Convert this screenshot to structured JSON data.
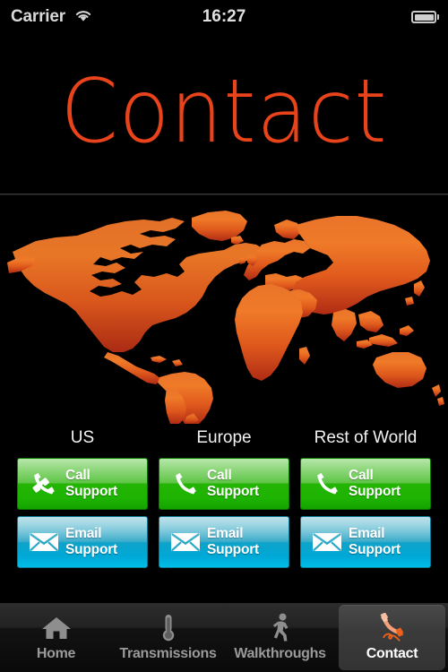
{
  "status_bar": {
    "carrier": "Carrier",
    "wifi_icon": "wifi-icon",
    "time": "16:27",
    "battery_icon": "battery-full-icon"
  },
  "header": {
    "title": "Contact",
    "title_color": "#e8431a"
  },
  "map": {
    "name": "world-map",
    "fill_top_color": "#ef7a2a",
    "fill_bottom_color": "#b52f16",
    "background_color": "#000000"
  },
  "support": {
    "columns": [
      {
        "region": "US",
        "call": {
          "line1": "Call",
          "line2": "Support",
          "icon": "phone-handset-icon"
        },
        "email": {
          "line1": "Email",
          "line2": "Support",
          "icon": "envelope-icon"
        }
      },
      {
        "region": "Europe",
        "call": {
          "line1": "Call",
          "line2": "Support",
          "icon": "phone-handset-icon"
        },
        "email": {
          "line1": "Email",
          "line2": "Support",
          "icon": "envelope-icon"
        }
      },
      {
        "region": "Rest of World",
        "call": {
          "line1": "Call",
          "line2": "Support",
          "icon": "phone-handset-icon"
        },
        "email": {
          "line1": "Email",
          "line2": "Support",
          "icon": "envelope-icon"
        }
      }
    ],
    "call_button_color": "#24b404",
    "email_button_color": "#00a8d6"
  },
  "tab_bar": {
    "items": [
      {
        "label": "Home",
        "icon": "house-icon",
        "active": false
      },
      {
        "label": "Transmissions",
        "icon": "thermometer-icon",
        "active": false
      },
      {
        "label": "Walkthroughs",
        "icon": "walking-person-icon",
        "active": false
      },
      {
        "label": "Contact",
        "icon": "phone-with-cord-icon",
        "active": true
      }
    ],
    "active_accent_color": "#f0793c"
  }
}
